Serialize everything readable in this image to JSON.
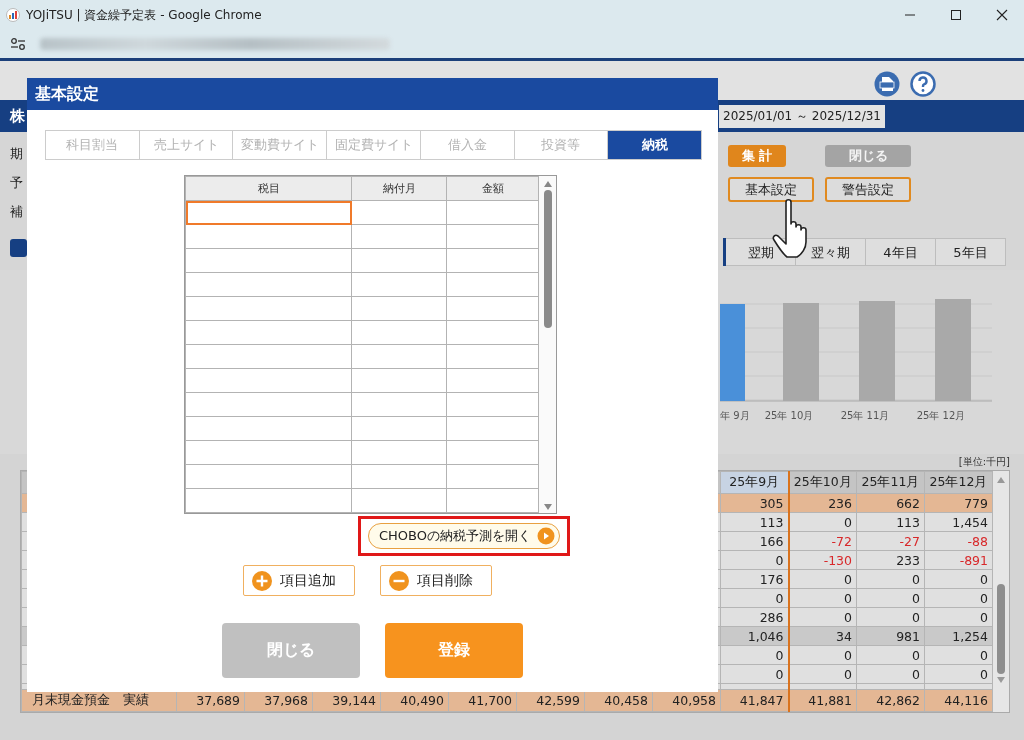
{
  "window": {
    "title": "YOJiTSU | 資金繰予定表 - Google Chrome"
  },
  "app": {
    "company": "株",
    "date_range": "2025/01/01 ～ 2025/12/31",
    "form_labels": [
      "期",
      "予",
      "補"
    ],
    "actions": [
      {
        "label": "集 計",
        "kind": "primary",
        "disabled": false
      },
      {
        "label": "閉じる",
        "kind": "primary",
        "disabled": true
      },
      {
        "label": "基本設定",
        "kind": "outline",
        "disabled": false
      },
      {
        "label": "警告設定",
        "kind": "outline",
        "disabled": false
      }
    ],
    "period_tabs": [
      {
        "label": "翌期",
        "selected": false
      },
      {
        "label": "翌々期",
        "selected": false
      },
      {
        "label": "4年目",
        "selected": false
      },
      {
        "label": "5年目",
        "selected": false
      }
    ],
    "chart": {
      "categories": [
        {
          "label": "年 9月",
          "current": true
        },
        {
          "label": "25年 10月",
          "current": false
        },
        {
          "label": "25年 11月",
          "current": false
        },
        {
          "label": "25年 12月",
          "current": false
        }
      ]
    },
    "table": {
      "unit": "[単位:千円]",
      "columns": [
        {
          "label": "25年9月",
          "current": true
        },
        {
          "label": "25年10月",
          "current": false
        },
        {
          "label": "25年11月",
          "current": false
        },
        {
          "label": "25年12月",
          "current": false
        }
      ],
      "rows": [
        {
          "kind": "income",
          "cells": [
            "305",
            "236",
            "662",
            "779"
          ],
          "negative": [
            false,
            false,
            false,
            false
          ]
        },
        {
          "kind": "plain",
          "cells": [
            "113",
            "0",
            "113",
            "1,454"
          ],
          "negative": [
            false,
            false,
            false,
            false
          ]
        },
        {
          "kind": "plain",
          "cells": [
            "166",
            "-72",
            "-27",
            "-88"
          ],
          "negative": [
            false,
            true,
            true,
            true
          ]
        },
        {
          "kind": "plain",
          "cells": [
            "0",
            "-130",
            "233",
            "-891"
          ],
          "negative": [
            false,
            true,
            false,
            true
          ]
        },
        {
          "kind": "plain",
          "cells": [
            "176",
            "0",
            "0",
            "0"
          ],
          "negative": [
            false,
            false,
            false,
            false
          ]
        },
        {
          "kind": "plain",
          "cells": [
            "0",
            "0",
            "0",
            "0"
          ],
          "negative": [
            false,
            false,
            false,
            false
          ]
        },
        {
          "kind": "plain",
          "cells": [
            "286",
            "0",
            "0",
            "0"
          ],
          "negative": [
            false,
            false,
            false,
            false
          ]
        },
        {
          "kind": "subtotal",
          "cells": [
            "1,046",
            "34",
            "981",
            "1,254"
          ],
          "negative": [
            false,
            false,
            false,
            false
          ]
        },
        {
          "kind": "plain",
          "cells": [
            "0",
            "0",
            "0",
            "0"
          ],
          "negative": [
            false,
            false,
            false,
            false
          ]
        },
        {
          "kind": "plain",
          "cells": [
            "0",
            "0",
            "0",
            "0"
          ],
          "negative": [
            false,
            false,
            false,
            false
          ]
        }
      ],
      "total_row": {
        "label": "月末現金預金　実績",
        "cells": [
          "37,689",
          "37,968",
          "39,144",
          "40,490",
          "41,700",
          "42,599",
          "40,458",
          "40,958",
          "41,847",
          "41,881",
          "42,862",
          "44,116"
        ]
      }
    }
  },
  "dialog": {
    "title": "基本設定",
    "tabs": [
      {
        "label": "科目割当",
        "selected": false
      },
      {
        "label": "売上サイト",
        "selected": false
      },
      {
        "label": "変動費サイト",
        "selected": false
      },
      {
        "label": "固定費サイト",
        "selected": false
      },
      {
        "label": "借入金",
        "selected": false
      },
      {
        "label": "投資等",
        "selected": false
      },
      {
        "label": "納税",
        "selected": true
      }
    ],
    "grid": {
      "columns": [
        "税目",
        "納付月",
        "金額"
      ],
      "rows": [
        {
          "focused": true
        },
        {
          "focused": false
        },
        {
          "focused": false
        },
        {
          "focused": false
        },
        {
          "focused": false
        },
        {
          "focused": false
        },
        {
          "focused": false
        },
        {
          "focused": false
        },
        {
          "focused": false
        },
        {
          "focused": false
        },
        {
          "focused": false
        },
        {
          "focused": false
        },
        {
          "focused": false
        }
      ]
    },
    "chobo_link": {
      "label": "CHOBOの納税予測を開く",
      "highlighted": true
    },
    "row_buttons": [
      {
        "label": "項目追加",
        "kind": "add"
      },
      {
        "label": "項目削除",
        "kind": "remove"
      }
    ],
    "buttons": [
      {
        "label": "閉じる",
        "kind": "secondary"
      },
      {
        "label": "登録",
        "kind": "primary"
      }
    ]
  }
}
